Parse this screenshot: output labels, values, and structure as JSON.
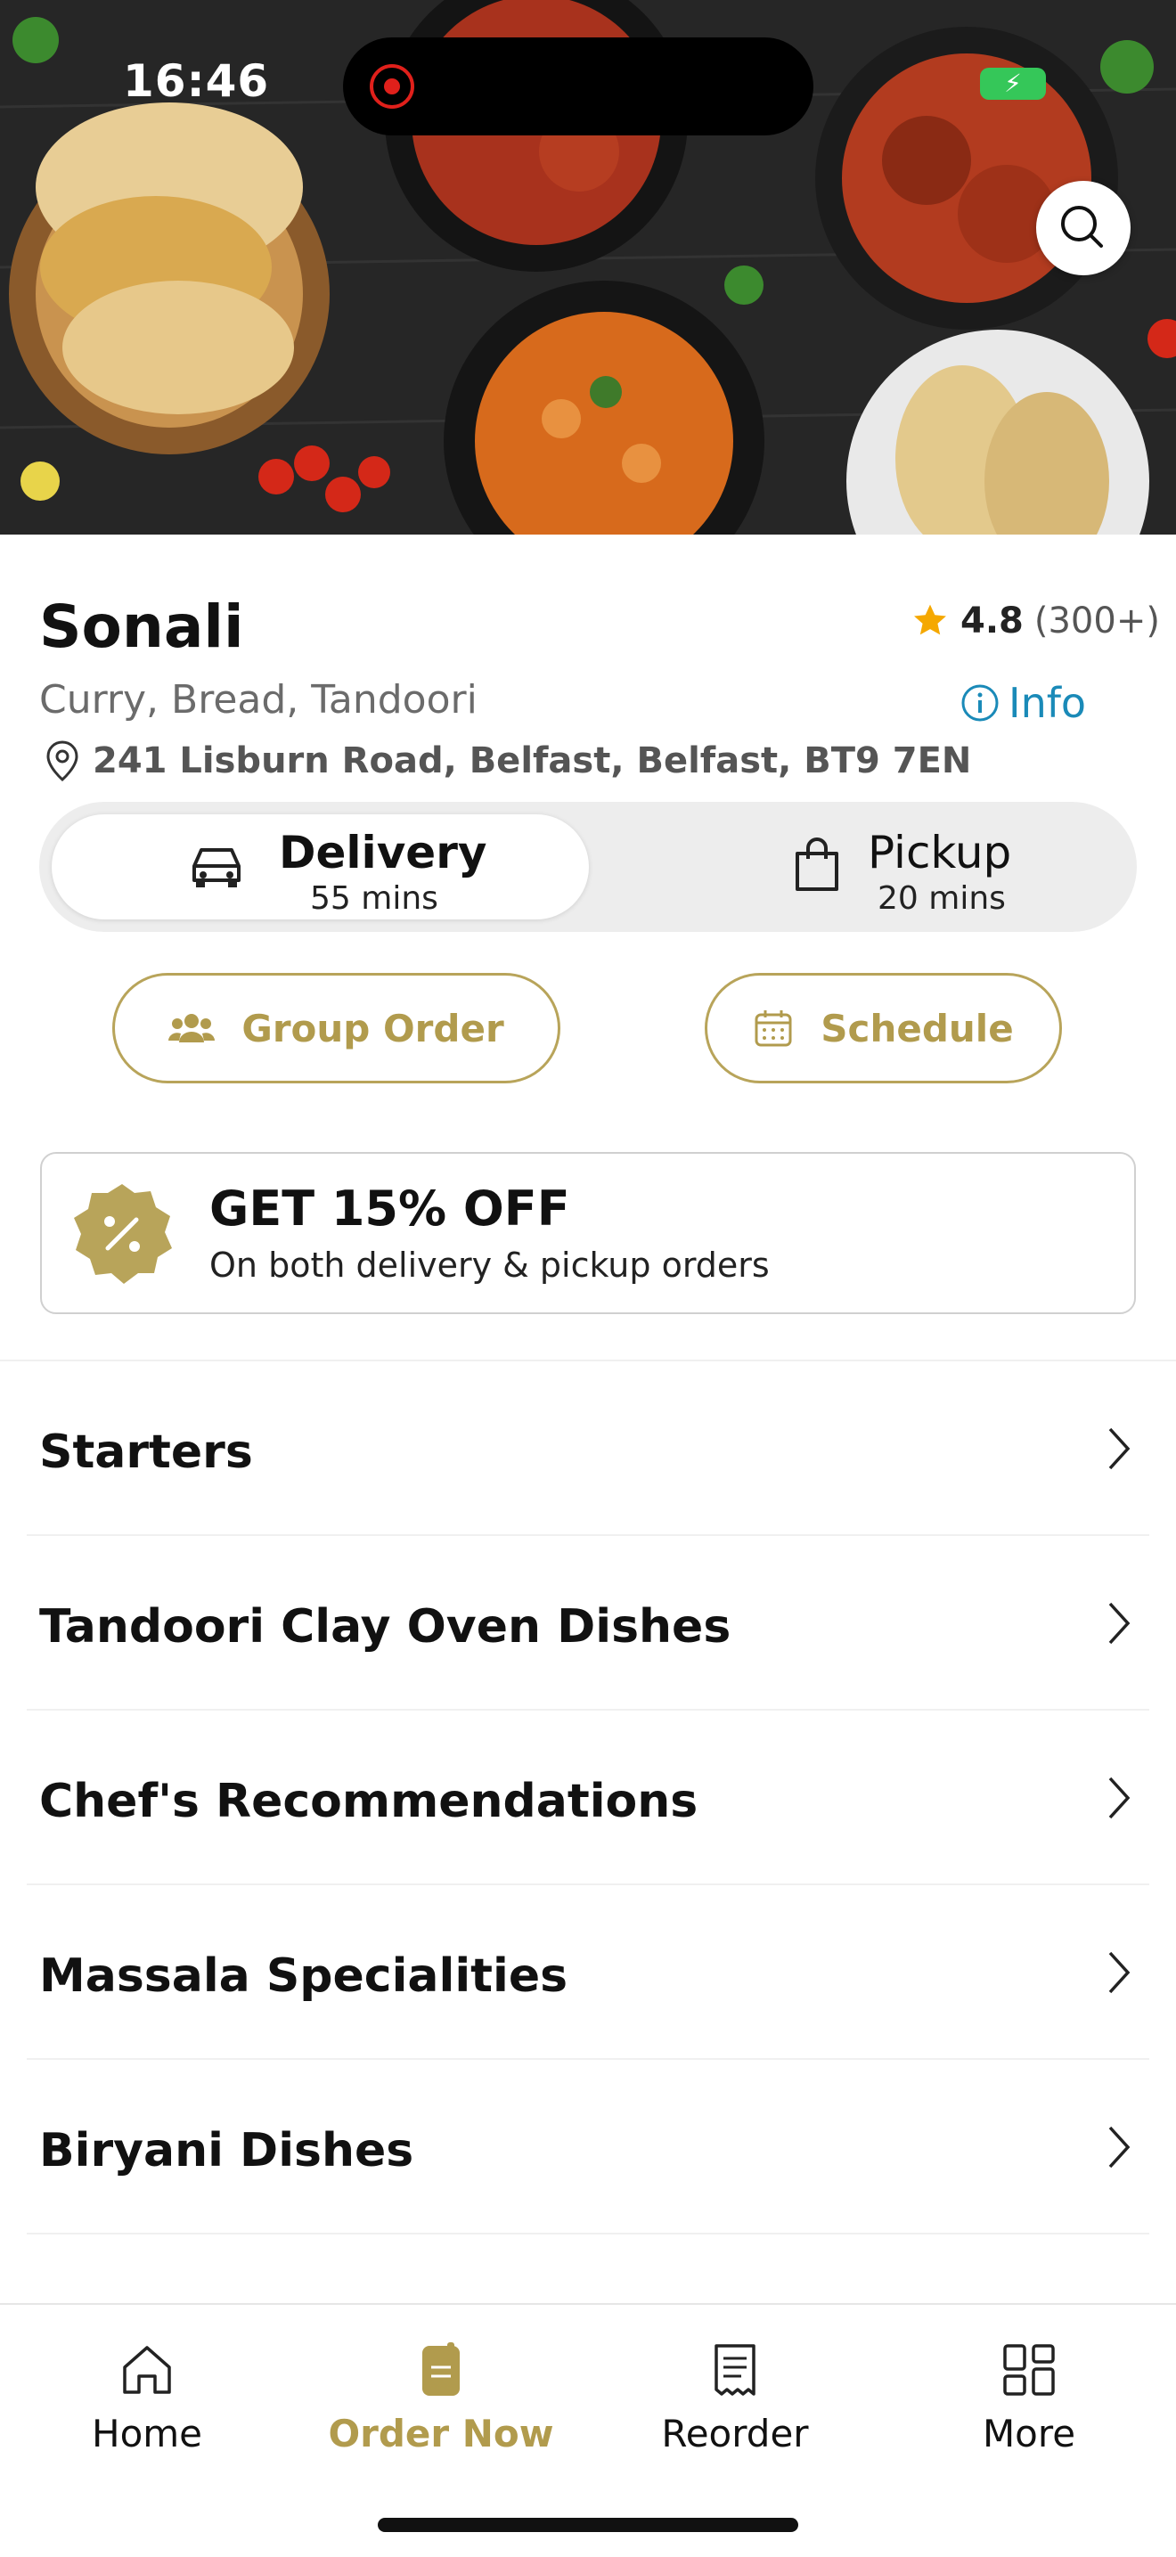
{
  "status_bar": {
    "time": "16:46",
    "battery_icon": "charging-bolt-icon"
  },
  "restaurant": {
    "name": "Sonali",
    "rating": "4.8",
    "rating_count": "(300+)",
    "cuisine": "Curry, Bread, Tandoori",
    "info_label": "Info",
    "address": "241 Lisburn Road, Belfast, Belfast, BT9 7EN"
  },
  "order_mode": {
    "selected": "delivery",
    "delivery": {
      "label": "Delivery",
      "time": "55 mins"
    },
    "pickup": {
      "label": "Pickup",
      "time": "20 mins"
    }
  },
  "actions": {
    "group_order": "Group Order",
    "schedule": "Schedule"
  },
  "promo": {
    "title": "GET 15% OFF",
    "subtitle": "On both delivery & pickup orders"
  },
  "categories": [
    {
      "label": "Starters"
    },
    {
      "label": "Tandoori Clay Oven Dishes"
    },
    {
      "label": "Chef's Recommendations"
    },
    {
      "label": "Massala Specialities"
    },
    {
      "label": "Biryani Dishes"
    }
  ],
  "bottom_nav": [
    {
      "label": "Home",
      "icon": "home-icon"
    },
    {
      "label": "Order Now",
      "icon": "order-icon",
      "active": true
    },
    {
      "label": "Reorder",
      "icon": "receipt-icon"
    },
    {
      "label": "More",
      "icon": "grid-icon"
    }
  ],
  "colors": {
    "accent_gold": "#b19b4d",
    "info_blue": "#1a8ab8",
    "star": "#f5a800"
  }
}
